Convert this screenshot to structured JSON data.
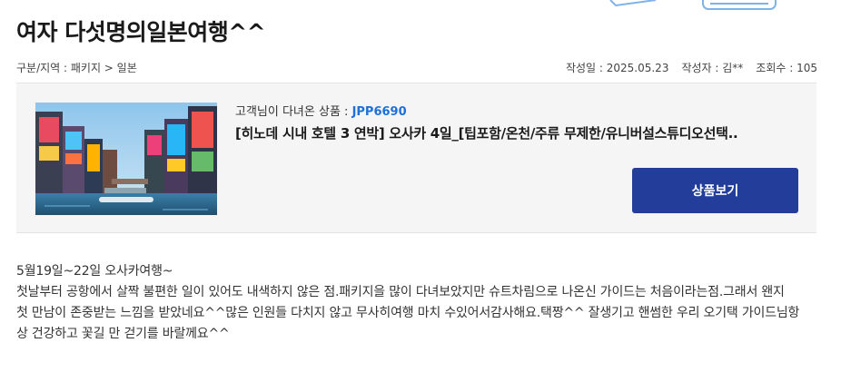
{
  "title": "여자 다섯명의일본여행^^",
  "meta": {
    "breadcrumb": "구분/지역 : 패키지 > 일본",
    "date_label": "작성일 : 2025.05.23",
    "author_label": "작성자 : 김**",
    "views_label": "조회수 : 105"
  },
  "product": {
    "subtitle_prefix": "고객님이 다녀온 상품 : ",
    "code": "JPP6690",
    "name": "[히노데 시내 호텔 3 연박] 오사카 4일_[팁포함/온천/주류 무제한/유니버설스튜디오선택..",
    "button_label": "상품보기",
    "image_icon": "osaka-dotonbori-photo"
  },
  "content": {
    "line1": "5월19일~22일 오사카여행~",
    "line2": "첫날부터  공항에서 살짝 불편한 일이 있어도 내색하지 않은 점.패키지을 많이 다녀보았지만 슈트차림으로 나온신 가이드는 처음이라는점.그래서 왠지",
    "line3": "첫 만남이 존중받는 느낌을 받았네요^^많은 인원들 다치지 않고 무사히여행 마치 수있어서감사해요.택짱^^ 잘생기고 핸썸한  우리 오기택 가이드님항",
    "line4": "상 건강하고 꽃길 만 걷기를 바랄께요^^"
  },
  "colors": {
    "accent_code": "#1e6fd9",
    "button_bg": "#233e9a",
    "box_bg": "#f5f5f5"
  }
}
